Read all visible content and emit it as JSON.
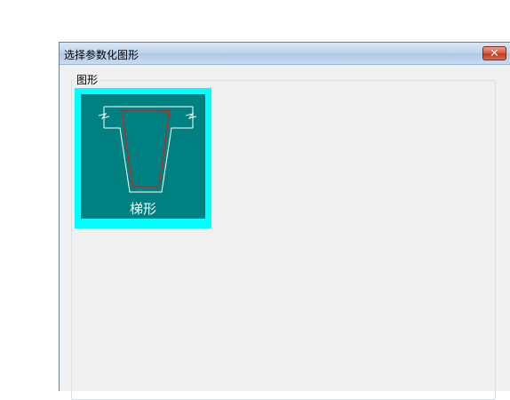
{
  "window": {
    "title": "选择参数化图形",
    "close_glyph": "✕"
  },
  "group": {
    "label": "图形"
  },
  "shapes": [
    {
      "label": "梯形",
      "icon": "trapezoid-section-icon",
      "selected": true
    }
  ],
  "colors": {
    "tile_highlight": "#00ffff",
    "tile_background": "#008080",
    "outline": "#ffffff",
    "trapezoid": "#a0302a"
  }
}
